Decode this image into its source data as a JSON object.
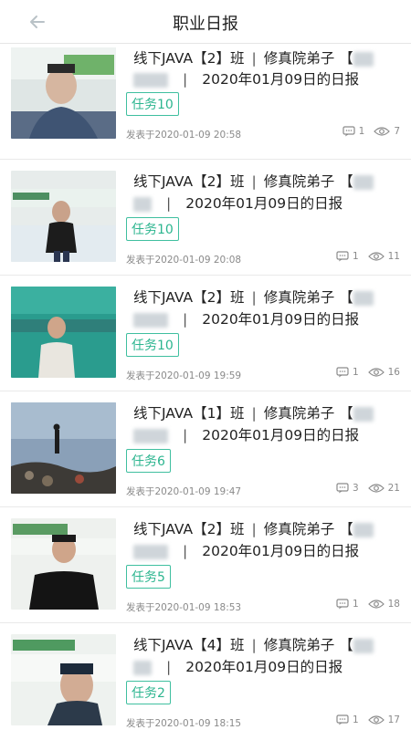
{
  "header": {
    "title": "职业日报"
  },
  "items": [
    {
      "class_text": "线下JAVA【2】班",
      "school": "修真院弟子",
      "bracket_open": "【",
      "date_text": "2020年01月09日的日报",
      "task": "任务10",
      "posted": "发表于2020-01-09 20:58",
      "comments": "1",
      "views": "7"
    },
    {
      "class_text": "线下JAVA【2】班",
      "school": "修真院弟子",
      "bracket_open": "【",
      "date_text": "2020年01月09日的日报",
      "task": "任务10",
      "posted": "发表于2020-01-09 20:08",
      "comments": "1",
      "views": "11"
    },
    {
      "class_text": "线下JAVA【2】班",
      "school": "修真院弟子",
      "bracket_open": "【",
      "date_text": "2020年01月09日的日报",
      "task": "任务10",
      "posted": "发表于2020-01-09 19:59",
      "comments": "1",
      "views": "16"
    },
    {
      "class_text": "线下JAVA【1】班",
      "school": "修真院弟子",
      "bracket_open": "【",
      "date_text": "2020年01月09日的日报",
      "task": "任务6",
      "posted": "发表于2020-01-09 19:47",
      "comments": "3",
      "views": "21"
    },
    {
      "class_text": "线下JAVA【2】班",
      "school": "修真院弟子",
      "bracket_open": "【",
      "date_text": "2020年01月09日的日报",
      "task": "任务5",
      "posted": "发表于2020-01-09 18:53",
      "comments": "1",
      "views": "18"
    },
    {
      "class_text": "线下JAVA【4】班",
      "school": "修真院弟子",
      "bracket_open": "【",
      "date_text": "2020年01月09日的日报",
      "task": "任务2",
      "posted": "发表于2020-01-09 18:15",
      "comments": "1",
      "views": "17"
    }
  ],
  "separator": "|",
  "colors": {
    "accent": "#2cb58f",
    "border": "#e9e9e9",
    "meta": "#8a8a8a"
  },
  "icons": {
    "back": "arrow-left-icon",
    "comment": "comment-icon",
    "views": "eye-icon"
  }
}
